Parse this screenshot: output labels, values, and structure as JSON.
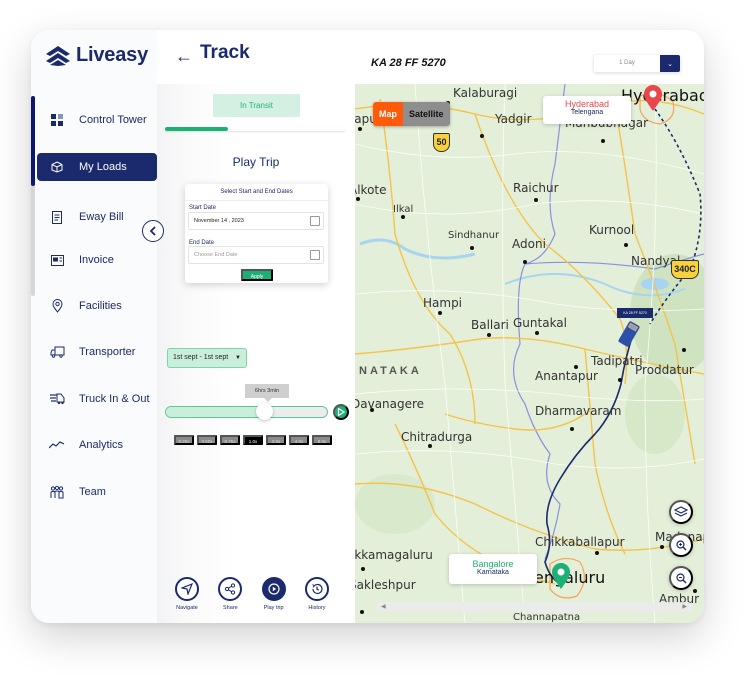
{
  "app": {
    "brand": "Liveasy",
    "page_title": "Track"
  },
  "sidebar": {
    "items": [
      {
        "label": "Control Tower",
        "icon": "grid-icon",
        "active": false
      },
      {
        "label": "My Loads",
        "icon": "box-icon",
        "active": true
      },
      {
        "label": "Eway Bill",
        "icon": "document-icon",
        "active": false
      },
      {
        "label": "Invoice",
        "icon": "invoice-icon",
        "active": false
      },
      {
        "label": "Facilities",
        "icon": "location-pin-icon",
        "active": false
      },
      {
        "label": "Transporter",
        "icon": "truck-icon",
        "active": false
      },
      {
        "label": "Truck In & Out",
        "icon": "fast-truck-icon",
        "active": false
      },
      {
        "label": "Analytics",
        "icon": "trend-line-icon",
        "active": false
      },
      {
        "label": "Team",
        "icon": "team-icon",
        "active": false
      }
    ]
  },
  "header": {
    "vehicle_number": "KA 28 FF 5270",
    "period": {
      "selected": "1 Day"
    }
  },
  "trip_panel": {
    "status": "In Transit",
    "trip_progress": 0.35,
    "play_trip_title": "Play Trip",
    "date_picker": {
      "heading": "Select Start and End Dates",
      "start_label": "Start Date",
      "start_value": "November 14 , 2023",
      "end_label": "End Date",
      "end_placeholder": "Choose End Date",
      "apply_label": "Apply"
    },
    "range_select": {
      "selected": "1st sept - 1st sept"
    },
    "playback": {
      "elapsed_tooltip": "6hrs 3min",
      "position": 0.61,
      "speeds": [
        "0.25x",
        "0.50x",
        "0.75x",
        "1.0x",
        "2.0x",
        "4.0x",
        "8.0x"
      ],
      "active_speed": "1.0x"
    },
    "actions": [
      {
        "label": "Navigate",
        "icon": "navigate-icon"
      },
      {
        "label": "Share",
        "icon": "share-icon"
      },
      {
        "label": "Play trip",
        "icon": "play-icon"
      },
      {
        "label": "History",
        "icon": "history-icon"
      }
    ]
  },
  "map": {
    "toggle": {
      "map_label": "Map",
      "satellite_label": "Satellite",
      "selected": "Map"
    },
    "origin": {
      "city": "Hyderabad",
      "state": "Telengana",
      "color": "#e8474c"
    },
    "destination": {
      "city": "Bangalore",
      "state": "Karnataka",
      "color": "#1db074"
    },
    "truck_label": "KA 28 FF 5270",
    "region_label": "NATAKA",
    "highway_shields": [
      "50",
      "340C"
    ],
    "cities": [
      "Kalaburagi",
      "Hyderabad",
      "Vapura",
      "Yadgir",
      "Mahbubnagar",
      "Alkote",
      "Raichur",
      "Ilkal",
      "Kurnool",
      "Sindhanur",
      "Adoni",
      "Nandyal",
      "Hampi",
      "Ballari",
      "Guntakal",
      "Tadipatri",
      "Proddatur",
      "Anantapur",
      "Davanagere",
      "Dharmavaram",
      "Chitradurga",
      "Madanapalle",
      "Chikkaballapur",
      "Chikkamagaluru",
      "Bengaluru",
      "Sakleshpur",
      "Ambur",
      "Channapatna"
    ]
  },
  "colors": {
    "brand_navy": "#1a2a6c",
    "success_green": "#1db074",
    "map_toggle_active": "#ff5a0a"
  }
}
